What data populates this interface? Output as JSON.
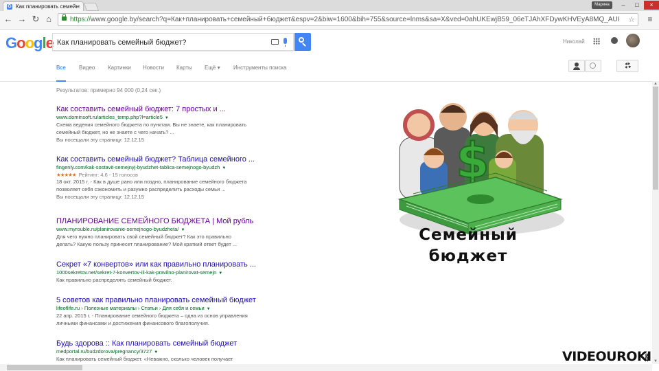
{
  "browser": {
    "tab_title": "Как планировать семейн",
    "tab_favicon": "G",
    "tab_close": "×",
    "profile_chip": "Марина",
    "url_scheme": "https://",
    "url_rest": "www.google.by/search?q=Как+планировать+семейный+бюджет&espv=2&biw=1600&bih=755&source=lnms&sa=X&ved=0ahUKEwjB59_06eTJAhXFDywKHVEyA8MQ_AUIBSgA&dpr=1#q",
    "nav_icons": [
      "back-arrow-icon",
      "forward-arrow-icon",
      "reload-icon",
      "home-icon"
    ],
    "win_controls": [
      "–",
      "□",
      "×"
    ]
  },
  "google": {
    "logo_letters": [
      "G",
      "o",
      "o",
      "g",
      "l",
      "e"
    ],
    "query": "Как планировать семейный бюджет?",
    "username": "Николай",
    "tabs": [
      "Все",
      "Видео",
      "Картинки",
      "Новости",
      "Карты",
      "Ещё ▾",
      "Инструменты поиска"
    ],
    "stats": "Результатов: примерно 94 000 (0,24 сек.)"
  },
  "results": [
    {
      "title": "Как составить семейный бюджет: 7 простых и ...",
      "url": "www.dominsoft.ru/articles_temp.php?l=article5",
      "snippet": [
        "Схема ведения семейного бюджета по пунктам. Вы не знаете, как планировать",
        "семейный бюджет, но не знаете с чего начать? ..."
      ],
      "visited": "Вы посещали эту страницу: 12.12.15",
      "title_visited": true
    },
    {
      "title": "Как составить семейный бюджет? Таблица семейного ...",
      "url": "fingenly.com/kak-sostavit-semejnyj-byudzhet-tablica-semejnogo-byudzh",
      "rating_stars": "★★★★★",
      "rating": "Рейтинг: 4,6 - 15 голосов",
      "snippet": [
        "18 окт. 2015 г. - Как в душе рано или поздно, планирование семейного бюджета",
        "позволяет себя сэкономить и разумно распределить расходы семьи ..."
      ],
      "visited": "Вы посещали эту страницу: 12.12.15",
      "title_visited": false
    },
    {
      "title": "ПЛАНИРОВАНИЕ СЕМЕЙНОГО БЮДЖЕТА | Мой рубль",
      "url": "www.myrouble.ru/planirovanie-semejnogo-byudzheta/",
      "snippet": [
        "Для чего нужно планировать свой семейный бюджет? Как это правильно",
        "делать? Какую пользу принесет планирование? Мой краткий ответ будет ..."
      ],
      "title_visited": true
    },
    {
      "title": "Секрет «7 конвертов» или как правильно планировать ...",
      "url": "1000sekretov.net/sekret-7-konvertov-ili-kak-pravilno-planirovat-semejn",
      "snippet": [
        "Как правильно распределять семейный бюджет."
      ],
      "title_visited": false
    },
    {
      "title": "5 советов как правильно планировать семейный бюджет",
      "url": "lifeoflife.ru › Полезные материалы › Статьи › Для себя и семьи",
      "snippet": [
        "22 апр. 2015 г. - Планирование семейного бюджета – одна из основ управления",
        "личными финансами и достижения финансового благополучия."
      ],
      "title_visited": false
    },
    {
      "title": "Будь здорова :: Как планировать семейный бюджет",
      "url": "medportal.ru/budzdorova/pregnancy/3727",
      "snippet": [
        "Как планировать семейный бюджет. «Неважно, сколько человек получает"
      ],
      "title_visited": false
    }
  ],
  "illustration": {
    "icon": "family-with-money-illustration",
    "caption_line1": "Семейный",
    "caption_line2": "бюджет"
  },
  "watermark": {
    "text": "VIDEOUROKI",
    "suffix": ".net"
  },
  "colors": {
    "link": "#1a0dab",
    "visited": "#660099",
    "url": "#006621",
    "accent": "#4285f4"
  }
}
